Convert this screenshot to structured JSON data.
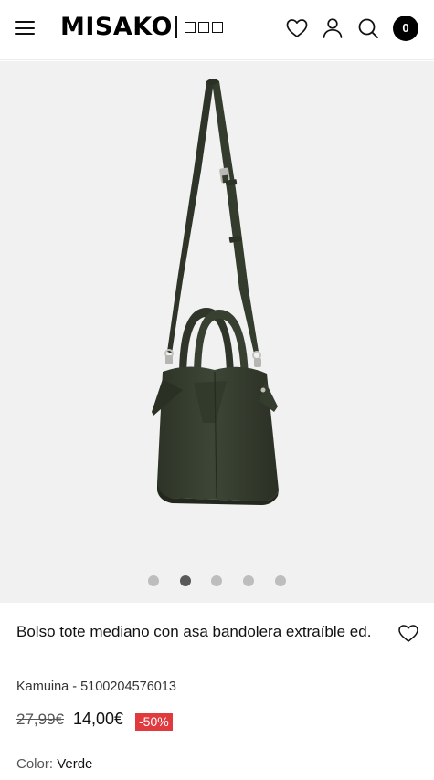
{
  "header": {
    "logo": "MISAKO",
    "cart_count": "0"
  },
  "gallery": {
    "image_alt": "Bolso tote mediano verde con asa bandolera",
    "current_slide": 2,
    "total_slides": 5
  },
  "product": {
    "title": "Bolso tote mediano con asa bandolera extraíble ed.",
    "reference": "Kamuina - 5100204576013",
    "old_price": "27,99€",
    "price": "14,00€",
    "discount": "-50%",
    "color_label": "Color:",
    "color_value": "Verde"
  },
  "colors": {
    "bag": "#3a4232",
    "discount_badge": "#e03a3e",
    "gallery_bg": "#f1f1f1"
  }
}
